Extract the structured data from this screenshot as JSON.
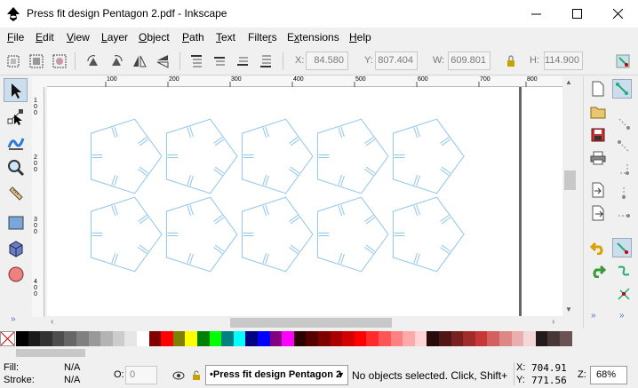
{
  "window": {
    "title": "Press fit design Pentagon 2.pdf - Inkscape",
    "minimize_icon": "minimize-icon",
    "maximize_icon": "maximize-icon",
    "close_icon": "close-icon"
  },
  "menubar": {
    "items": [
      {
        "label": "File",
        "ul": "F"
      },
      {
        "label": "Edit",
        "ul": "E"
      },
      {
        "label": "View",
        "ul": "V"
      },
      {
        "label": "Layer",
        "ul": "L"
      },
      {
        "label": "Object",
        "ul": "O"
      },
      {
        "label": "Path",
        "ul": "P"
      },
      {
        "label": "Text",
        "ul": "T"
      },
      {
        "label": "Filters",
        "ul": "r"
      },
      {
        "label": "Extensions",
        "ul": "x"
      },
      {
        "label": "Help",
        "ul": "H"
      }
    ]
  },
  "toolcontrols": {
    "x_label": "X:",
    "x_value": "84.580",
    "y_label": "Y:",
    "y_value": "807.404",
    "w_label": "W:",
    "w_value": "609.801",
    "h_label": "H:",
    "h_value": "114.900"
  },
  "ruler": {
    "top_labels": [
      "100",
      "200",
      "300",
      "400",
      "500",
      "600",
      "700",
      "800"
    ],
    "left_labels": [
      "100",
      "200",
      "300",
      "400"
    ]
  },
  "palette": {
    "colors": [
      "#000000",
      "#1a1a1a",
      "#333333",
      "#4d4d4d",
      "#666666",
      "#808080",
      "#999999",
      "#b3b3b3",
      "#cccccc",
      "#e6e6e6",
      "#ffffff",
      "#800000",
      "#ff0000",
      "#808000",
      "#ffff00",
      "#008000",
      "#00ff00",
      "#008080",
      "#00ffff",
      "#000080",
      "#0000ff",
      "#800080",
      "#ff00ff",
      "#2b0000",
      "#550000",
      "#800000",
      "#aa0000",
      "#d40000",
      "#ff0000",
      "#ff2a2a",
      "#ff5555",
      "#ff8080",
      "#ffaaaa",
      "#ffd5d5",
      "#280b0b",
      "#501616",
      "#782121",
      "#a02c2c",
      "#c83737",
      "#d35f5f",
      "#de8787",
      "#e9afaf",
      "#f4d7d7",
      "#241c1c",
      "#483737",
      "#6c5353"
    ]
  },
  "status": {
    "fill_label": "Fill:",
    "fill_value": "N/A",
    "stroke_label": "Stroke:",
    "stroke_value": "N/A",
    "opacity_label": "O:",
    "opacity_value": "0",
    "layer_value": "•Press fit design Pentagon 2",
    "message": "No objects selected. Click, Shift+",
    "x_label": "X:",
    "x_value": "704.91",
    "y_label": "Y:",
    "y_value": "771.56",
    "zoom_label": "Z:",
    "zoom_value": "68%"
  }
}
